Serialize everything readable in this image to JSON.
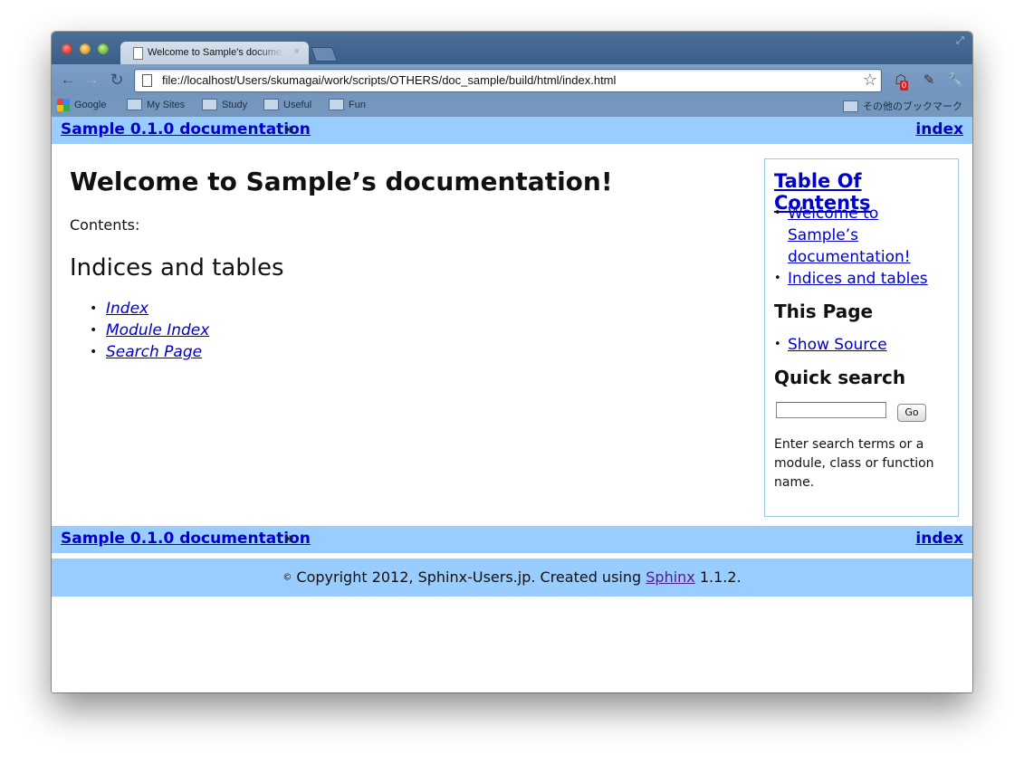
{
  "browser": {
    "tab_title": "Welcome to Sample's documentation!",
    "tab_close": "×",
    "url": "file://localhost/Users/skumagai/work/scripts/OTHERS/doc_sample/build/html/index.html",
    "back_glyph": "←",
    "forward_glyph": "→",
    "reload_glyph": "↻",
    "star_glyph": "☆",
    "fullscreen_glyph": "⤢",
    "ext_badge": "0",
    "ext_glyph": "☖",
    "ext2_glyph": "✎",
    "wrench_glyph": "🔧"
  },
  "bookmarks": [
    {
      "label": "Google",
      "icon": "google-icon"
    },
    {
      "label": "My Sites",
      "icon": "folder-icon"
    },
    {
      "label": "Study",
      "icon": "folder-icon"
    },
    {
      "label": "Useful",
      "icon": "folder-icon"
    },
    {
      "label": "Fun",
      "icon": "folder-icon"
    },
    {
      "label": "その他のブックマーク",
      "icon": "folder-icon"
    }
  ],
  "relbar": {
    "home_link": "Sample 0.1.0 documentation",
    "separator": "»",
    "index_link": "index"
  },
  "content": {
    "title": "Welcome to Sample’s documentation!",
    "contents_label": "Contents:",
    "indices_heading": "Indices and tables",
    "indices": [
      "Index",
      "Module Index",
      "Search Page"
    ]
  },
  "sidebar": {
    "toc_title": "Table Of Contents",
    "toc_items": [
      "Welcome to Sample’s documentation!",
      "Indices and tables"
    ],
    "this_page_heading": "This Page",
    "show_source": "Show Source",
    "quick_search_heading": "Quick search",
    "search_value": "",
    "go_label": "Go",
    "search_hint": "Enter search terms or a module, class or function name."
  },
  "footer": {
    "copyright_symbol": "©",
    "text_before": "Copyright 2012, Sphinx-Users.jp. Created using",
    "sphinx_link": "Sphinx",
    "text_after": "1.1.2."
  },
  "colors": {
    "relbar_bg": "#99ccff",
    "link": "#0000cc",
    "visited_link": "#551a8b",
    "tabstrip": "#3f648c"
  }
}
